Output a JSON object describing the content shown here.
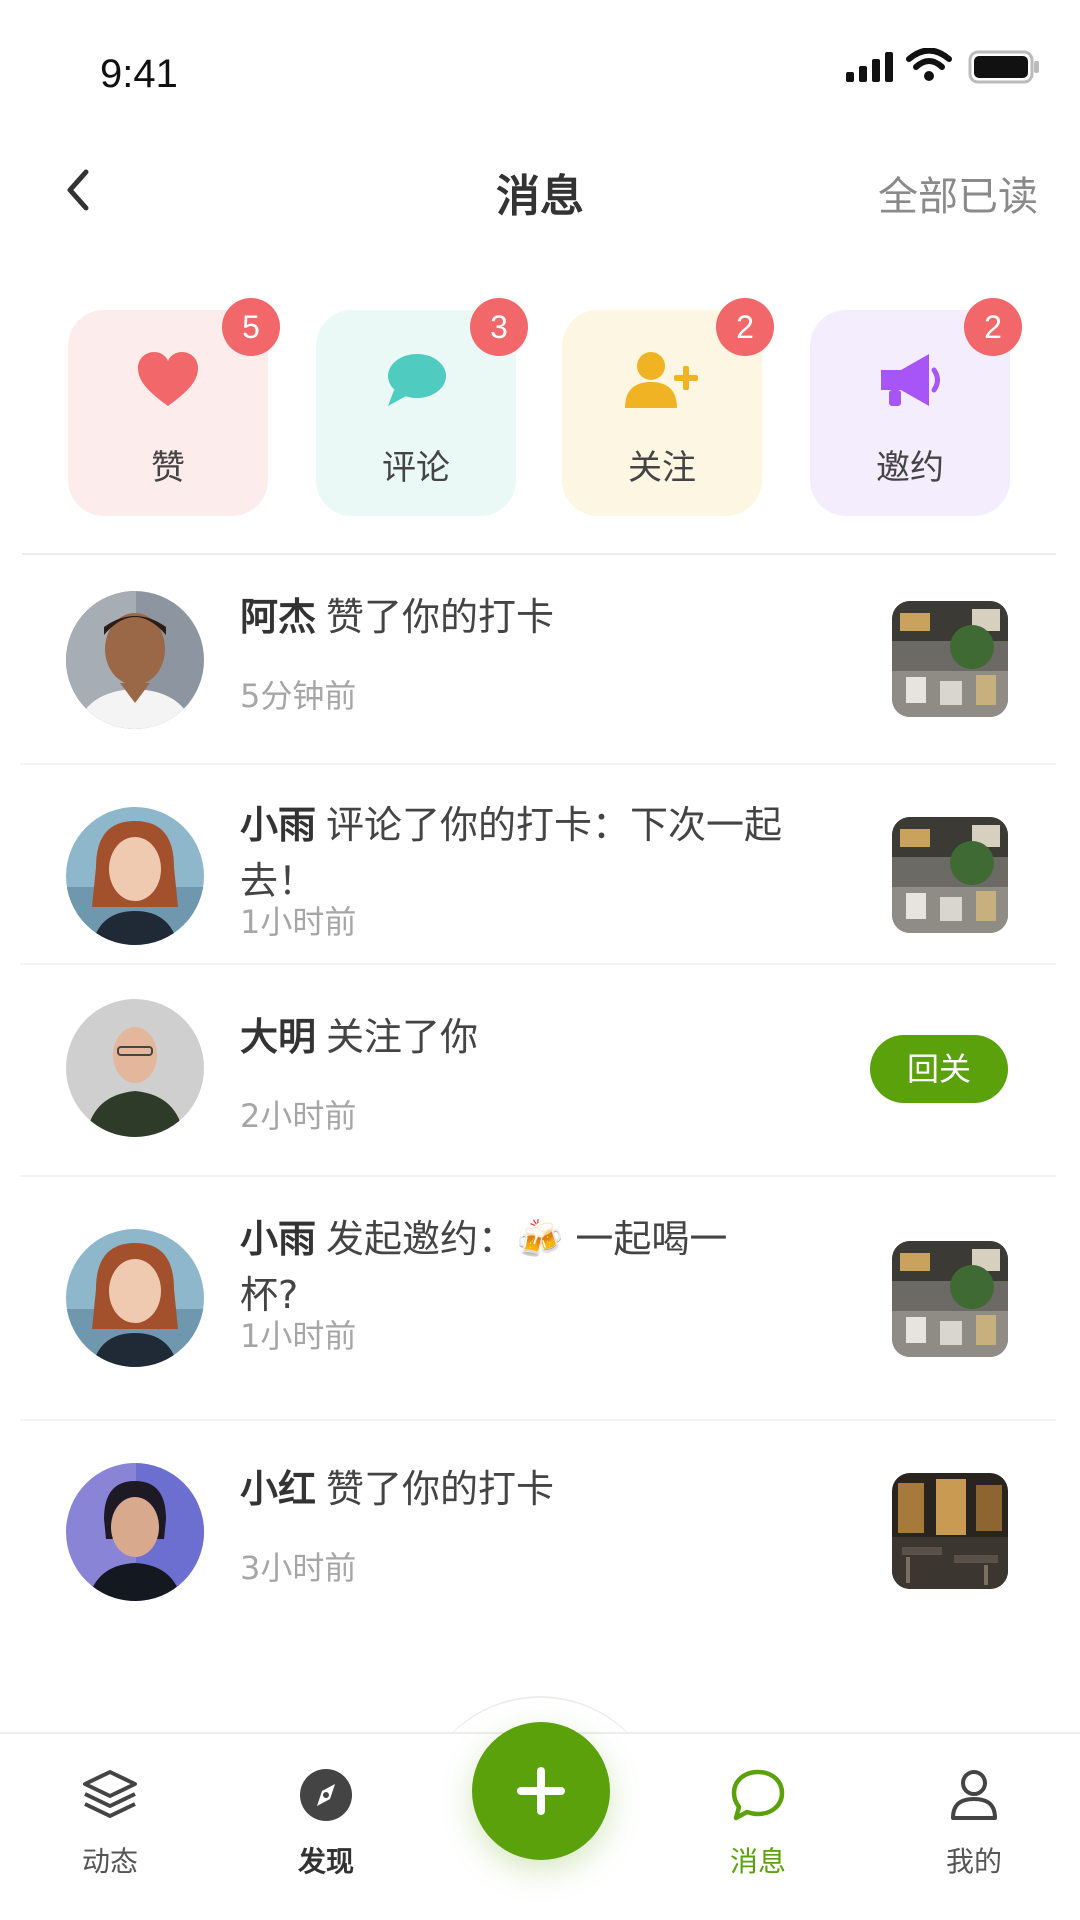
{
  "status_bar": {
    "time": "9:41"
  },
  "header": {
    "title": "消息",
    "mark_all_read": "全部已读"
  },
  "categories": [
    {
      "label": "赞",
      "count": "5",
      "icon": "heart-icon",
      "bg": "#fdecec",
      "color": "#f2676a"
    },
    {
      "label": "评论",
      "count": "3",
      "icon": "comment-icon",
      "bg": "#eaf8f6",
      "color": "#4fcbc0"
    },
    {
      "label": "关注",
      "count": "2",
      "icon": "user-plus-icon",
      "bg": "#fdf6e3",
      "color": "#f0b323"
    },
    {
      "label": "邀约",
      "count": "2",
      "icon": "megaphone-icon",
      "bg": "#f4edfd",
      "color": "#a855f7"
    }
  ],
  "messages": [
    {
      "name": "阿杰",
      "text": "赞了你的打卡",
      "time": "5分钟前",
      "action": "thumbnail"
    },
    {
      "name": "小雨",
      "text": "评论了你的打卡：下次一起去！",
      "time": "1小时前",
      "action": "thumbnail"
    },
    {
      "name": "大明",
      "text": "关注了你",
      "time": "2小时前",
      "action": "button",
      "button_label": "回关"
    },
    {
      "name": "小雨",
      "text": "发起邀约：🍻 一起喝一杯?",
      "time": "1小时前",
      "action": "thumbnail"
    },
    {
      "name": "小红",
      "text": "赞了你的打卡",
      "time": "3小时前",
      "action": "thumbnail"
    }
  ],
  "tabbar": {
    "items": [
      {
        "label": "动态",
        "icon": "layers-icon"
      },
      {
        "label": "发现",
        "icon": "compass-icon"
      },
      {
        "label": "消息",
        "icon": "chat-bubble-icon"
      },
      {
        "label": "我的",
        "icon": "user-icon"
      }
    ],
    "fab_icon": "plus-icon",
    "accent": "#5aa10c"
  }
}
